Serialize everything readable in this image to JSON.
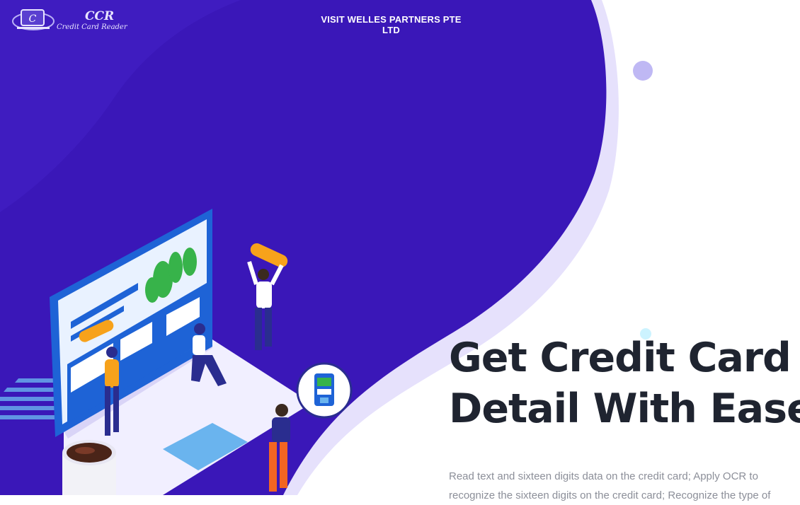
{
  "logo": {
    "mark": "C",
    "title": "CCR",
    "subtitle": "Credit Card Reader"
  },
  "nav": {
    "visit_link": "VISIT WELLES PARTNERS PTE LTD"
  },
  "hero": {
    "title_line1": "Get Credit Card",
    "title_line2": "Detail With Ease",
    "description": "Read text and sixteen digits data on the credit card; Apply OCR to recognize the sixteen digits on the credit card; Recognize the type of"
  },
  "colors": {
    "primary_purple": "#3a17b8",
    "wave_shadow": "#e4e0fb",
    "title_text": "#1f2430",
    "body_text": "#8c8f99"
  },
  "icons": [
    "credit-card-logo-icon",
    "laptop-illustration",
    "phone-card-icon",
    "coffee-cup-icon"
  ]
}
